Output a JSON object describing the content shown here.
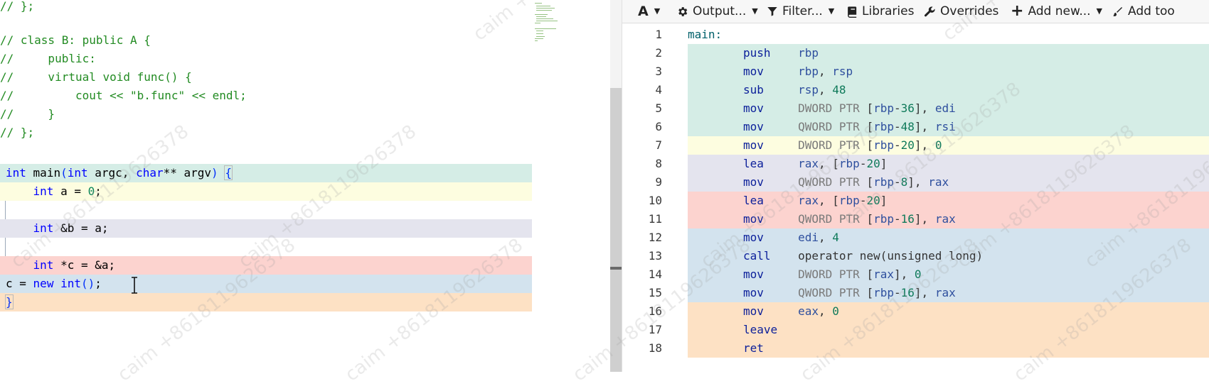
{
  "colors": {
    "green": "#d5ede6",
    "yellow": "#fdfde0",
    "lavender": "#e4e4ee",
    "red": "#fcd3cf",
    "blue": "#d3e3ee",
    "orange": "#fde1c4"
  },
  "editor": {
    "source_lines": [
      "// };",
      "",
      "// class B: public A {",
      "//     public:",
      "//     virtual void func() {",
      "//         cout << \"b.func\" << endl;",
      "//     }",
      "// };",
      "",
      "int main(int argc, char** argv) {",
      "    int a = 0;",
      "",
      "    int &b = a;",
      "",
      "    int *c = &a;",
      "c = new int();",
      "}"
    ]
  },
  "toolbar": {
    "font_label": "A",
    "output_label": "Output...",
    "filter_label": "Filter...",
    "libraries_label": "Libraries",
    "overrides_label": "Overrides",
    "add_new_label": "Add new...",
    "add_tool_label": "Add too"
  },
  "assembly": {
    "lines": [
      {
        "num": "1",
        "text": "main:",
        "color": ""
      },
      {
        "num": "2",
        "text": "push    rbp",
        "color": "green"
      },
      {
        "num": "3",
        "text": "mov     rbp, rsp",
        "color": "green"
      },
      {
        "num": "4",
        "text": "sub     rsp, 48",
        "color": "green"
      },
      {
        "num": "5",
        "text": "mov     DWORD PTR [rbp-36], edi",
        "color": "green"
      },
      {
        "num": "6",
        "text": "mov     QWORD PTR [rbp-48], rsi",
        "color": "green"
      },
      {
        "num": "7",
        "text": "mov     DWORD PTR [rbp-20], 0",
        "color": "yellow"
      },
      {
        "num": "8",
        "text": "lea     rax, [rbp-20]",
        "color": "lavender"
      },
      {
        "num": "9",
        "text": "mov     QWORD PTR [rbp-8], rax",
        "color": "lavender"
      },
      {
        "num": "10",
        "text": "lea     rax, [rbp-20]",
        "color": "red"
      },
      {
        "num": "11",
        "text": "mov     QWORD PTR [rbp-16], rax",
        "color": "red"
      },
      {
        "num": "12",
        "text": "mov     edi, 4",
        "color": "blue"
      },
      {
        "num": "13",
        "text": "call    operator new(unsigned long)",
        "color": "blue"
      },
      {
        "num": "14",
        "text": "mov     DWORD PTR [rax], 0",
        "color": "blue"
      },
      {
        "num": "15",
        "text": "mov     QWORD PTR [rbp-16], rax",
        "color": "blue"
      },
      {
        "num": "16",
        "text": "mov     eax, 0",
        "color": "orange"
      },
      {
        "num": "17",
        "text": "leave",
        "color": "orange"
      },
      {
        "num": "18",
        "text": "ret",
        "color": "orange"
      }
    ]
  },
  "watermark": {
    "texts": [
      "caim +8618119626378"
    ]
  }
}
